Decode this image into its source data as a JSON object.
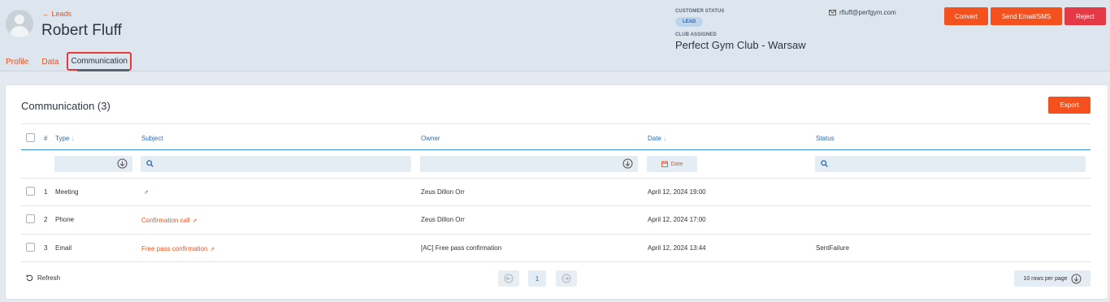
{
  "header": {
    "back_link": "← Leads",
    "person_name": "Robert Fluff",
    "tabs": [
      {
        "label": "Profile"
      },
      {
        "label": "Data"
      },
      {
        "label": "Communication"
      }
    ],
    "customer_status_label": "CUSTOMER STATUS",
    "customer_status_value": "LEAD",
    "club_assigned_label": "CLUB ASSIGNED",
    "club_assigned_value": "Perfect Gym Club - Warsaw",
    "email": "rfluff@perfgym.com",
    "actions": {
      "convert": "Convert",
      "send": "Send Email/SMS",
      "reject": "Reject"
    }
  },
  "communication": {
    "title": "Communication (3)",
    "export_label": "Export",
    "columns": {
      "num": "#",
      "type": "Type",
      "subject": "Subject",
      "owner": "Owner",
      "date": "Date",
      "status": "Status"
    },
    "date_filter_label": "Date",
    "rows": [
      {
        "num": "1",
        "type": "Meeting",
        "subject": "",
        "owner": "Zeus Dillon Orr",
        "date": "April 12, 2024 19:00",
        "status": ""
      },
      {
        "num": "2",
        "type": "Phone",
        "subject": "Confirmation call",
        "owner": "Zeus Dillon Orr",
        "date": "April 12, 2024 17:00",
        "status": ""
      },
      {
        "num": "3",
        "type": "Email",
        "subject": "Free pass confirmation",
        "owner": "[AC] Free pass confirmation",
        "date": "April 12, 2024 13:44",
        "status": "SentFailure"
      }
    ],
    "footer": {
      "refresh_label": "Refresh",
      "current_page": "1",
      "rows_per_page": "10 rows per page"
    }
  },
  "colors": {
    "accent": "#f4511e",
    "danger": "#e53945",
    "link_blue": "#2c6bb5",
    "header_bg": "#dde6ee"
  },
  "icons": [
    "user-avatar-icon",
    "mail-icon",
    "sort-arrow-icon",
    "chevron-down-circle-icon",
    "search-icon",
    "calendar-icon",
    "link-icon",
    "refresh-icon",
    "arrow-left-circle-icon",
    "arrow-right-circle-icon"
  ]
}
